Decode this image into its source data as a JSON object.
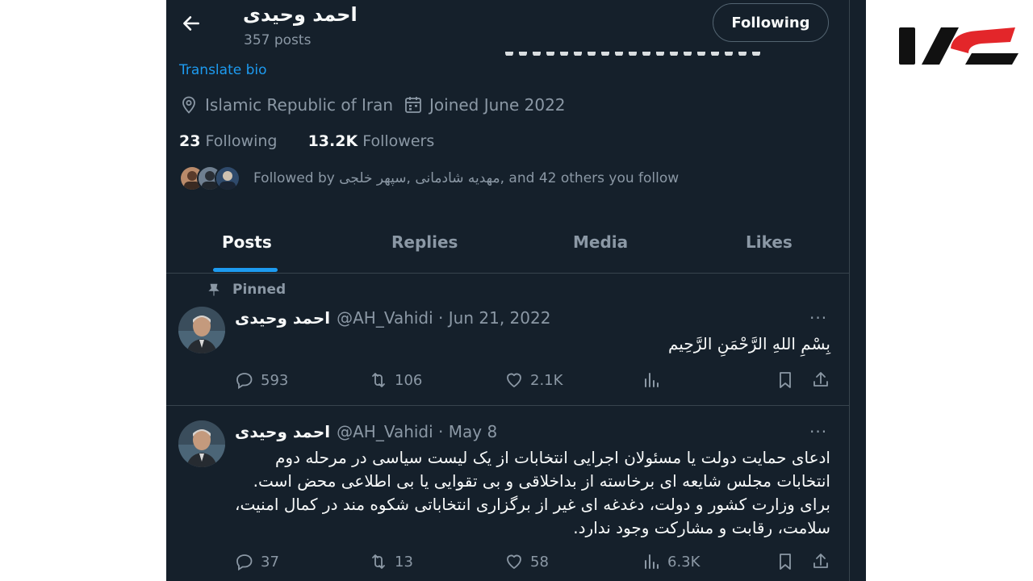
{
  "profile": {
    "name": "احمد وحیدی",
    "posts_count": "357 posts",
    "follow_button": "Following",
    "translate_bio": "Translate bio",
    "location": "Islamic Republic of Iran",
    "joined": "Joined June 2022",
    "following_count": "23",
    "following_label": "Following",
    "followers_count": "13.2K",
    "followers_label": "Followers",
    "followed_by": "Followed by مهدیه شادمانی ,سپهر خلجی, and 42 others you follow"
  },
  "tabs": [
    {
      "label": "Posts",
      "active": true
    },
    {
      "label": "Replies",
      "active": false
    },
    {
      "label": "Media",
      "active": false
    },
    {
      "label": "Likes",
      "active": false
    }
  ],
  "tweets": [
    {
      "pinned_label": "Pinned",
      "name": "احمد وحیدی",
      "handle": "@AH_Vahidi",
      "date": "Jun 21, 2022",
      "more": "···",
      "text": "بِسْمِ اللهِ الرَّحْمَنِ الرَّحِيم",
      "replies": "593",
      "reposts": "106",
      "likes": "2.1K",
      "views": ""
    },
    {
      "name": "احمد وحیدی",
      "handle": "@AH_Vahidi",
      "date": "May 8",
      "more": "···",
      "text": "ادعای حمایت دولت یا مسئولان اجرایی انتخابات از یک لیست سیاسی در مرحله دوم انتخابات مجلس شایعه ای برخاسته از بداخلاقی و بی تقوایی یا بی اطلاعی محض است. برای وزارت کشور و دولت، دغدغه ای غیر از برگزاری انتخاباتی شکوه مند در کمال امنیت، سلامت، رقابت و مشارکت وجود ندارد.",
      "replies": "37",
      "reposts": "13",
      "likes": "58",
      "views": "6.3K"
    }
  ],
  "icons": [
    "back-arrow-icon",
    "location-pin-icon",
    "calendar-icon",
    "pin-icon",
    "reply-icon",
    "repost-icon",
    "like-icon",
    "views-icon",
    "bookmark-icon",
    "share-icon"
  ],
  "colors": {
    "background": "#15202b",
    "accent": "#1d9bf0",
    "muted": "#8b98a5",
    "text": "#f7f9f9",
    "logo_red": "#e3262a"
  }
}
